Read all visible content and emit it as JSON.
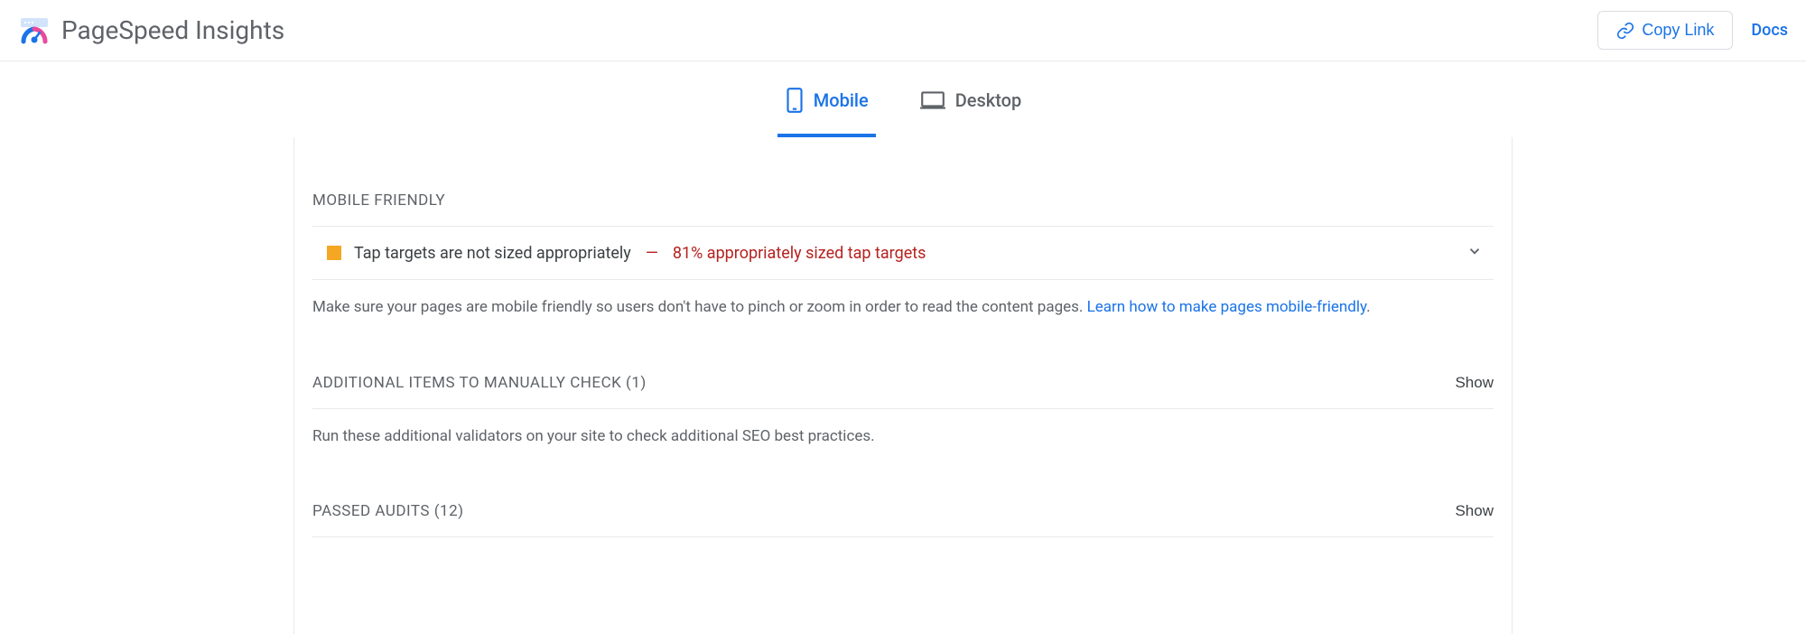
{
  "header": {
    "title": "PageSpeed Insights",
    "copy_link_label": "Copy Link",
    "docs_label": "Docs"
  },
  "tabs": {
    "mobile_label": "Mobile",
    "desktop_label": "Desktop"
  },
  "sections": {
    "mobile_friendly": {
      "title": "MOBILE FRIENDLY",
      "audit": {
        "title": "Tap targets are not sized appropriately",
        "detail": "81% appropriately sized tap targets",
        "dash": "—"
      },
      "description_text": "Make sure your pages are mobile friendly so users don't have to pinch or zoom in order to read the content pages. ",
      "description_link": "Learn how to make pages mobile-friendly",
      "description_period": "."
    },
    "additional": {
      "title": "ADDITIONAL ITEMS TO MANUALLY CHECK",
      "count": "(1)",
      "show_label": "Show",
      "description": "Run these additional validators on your site to check additional SEO best practices."
    },
    "passed": {
      "title": "PASSED AUDITS",
      "count": "(12)",
      "show_label": "Show"
    }
  }
}
